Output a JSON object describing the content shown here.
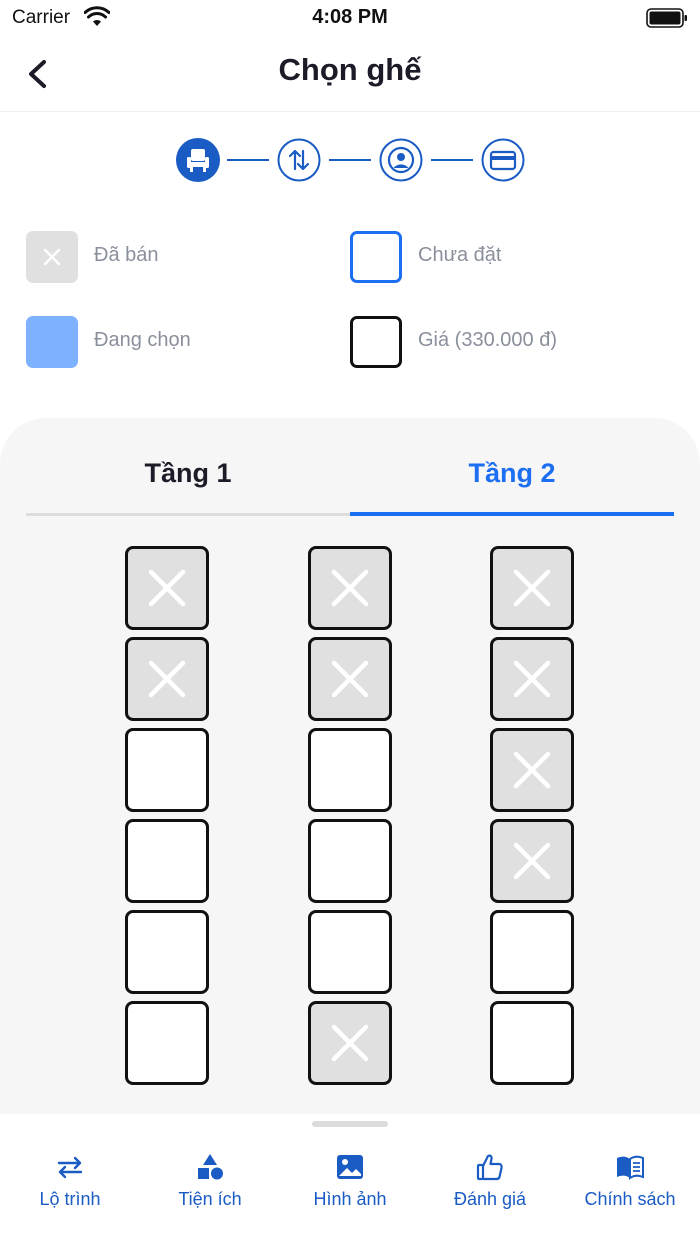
{
  "status_bar": {
    "carrier": "Carrier",
    "time": "4:08 PM"
  },
  "header": {
    "title": "Chọn ghế"
  },
  "stepper": {
    "steps": [
      {
        "icon": "seat-icon",
        "active": true
      },
      {
        "icon": "swap-vertical-icon",
        "active": false
      },
      {
        "icon": "user-circle-icon",
        "active": false
      },
      {
        "icon": "credit-card-icon",
        "active": false
      }
    ]
  },
  "legend": {
    "sold": "Đã bán",
    "available": "Chưa đặt",
    "selecting": "Đang chọn",
    "price": "Giá (330.000 đ)"
  },
  "tabs": [
    {
      "label": "Tầng 1",
      "active": false
    },
    {
      "label": "Tầng 2",
      "active": true
    }
  ],
  "seat_grid": {
    "columns": 3,
    "rows": [
      [
        "sold",
        "sold",
        "sold"
      ],
      [
        "sold",
        "sold",
        "sold"
      ],
      [
        "available",
        "available",
        "sold"
      ],
      [
        "available",
        "available",
        "sold"
      ],
      [
        "available",
        "available",
        "available"
      ],
      [
        "available",
        "sold",
        "available"
      ]
    ]
  },
  "bottom_nav": [
    {
      "label": "Lộ trình",
      "icon": "route-arrows-icon"
    },
    {
      "label": "Tiện ích",
      "icon": "shapes-icon"
    },
    {
      "label": "Hình ảnh",
      "icon": "image-icon"
    },
    {
      "label": "Đánh giá",
      "icon": "thumbs-up-icon"
    },
    {
      "label": "Chính sách",
      "icon": "book-icon"
    }
  ],
  "colors": {
    "accent": "#1c6ef2",
    "icon_blue": "#1a5bc4",
    "sold_fill": "#e0e0e0",
    "selecting_fill": "#7eb1ff",
    "panel_bg": "#f6f6f6"
  }
}
